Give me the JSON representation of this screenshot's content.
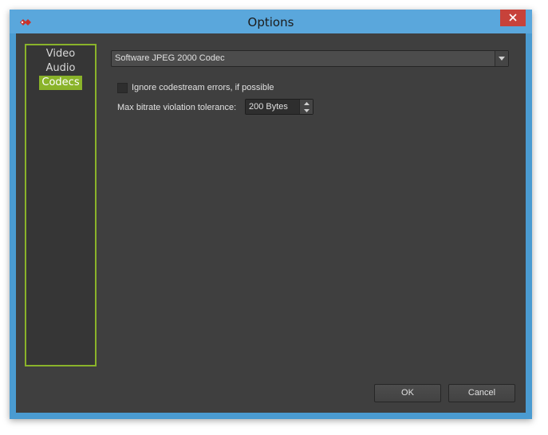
{
  "window": {
    "title": "Options",
    "app_icon": "app-logo-icon",
    "close_icon": "close-icon"
  },
  "nav": {
    "items": [
      {
        "label": "Video",
        "selected": false
      },
      {
        "label": "Audio",
        "selected": false
      },
      {
        "label": "Codecs",
        "selected": true
      }
    ]
  },
  "codec": {
    "selected": "Software JPEG 2000 Codec",
    "arrow_icon": "chevron-down-icon"
  },
  "options": {
    "ignore_errors_label": "Ignore codestream errors, if possible",
    "ignore_errors_checked": false,
    "tolerance_label": "Max bitrate violation tolerance:",
    "tolerance_value": "200 Bytes"
  },
  "buttons": {
    "ok": "OK",
    "cancel": "Cancel"
  },
  "colors": {
    "accent": "#8ab32a",
    "titlebar": "#5aa7dc",
    "close": "#c7423a",
    "panel": "#3f3f3f"
  }
}
